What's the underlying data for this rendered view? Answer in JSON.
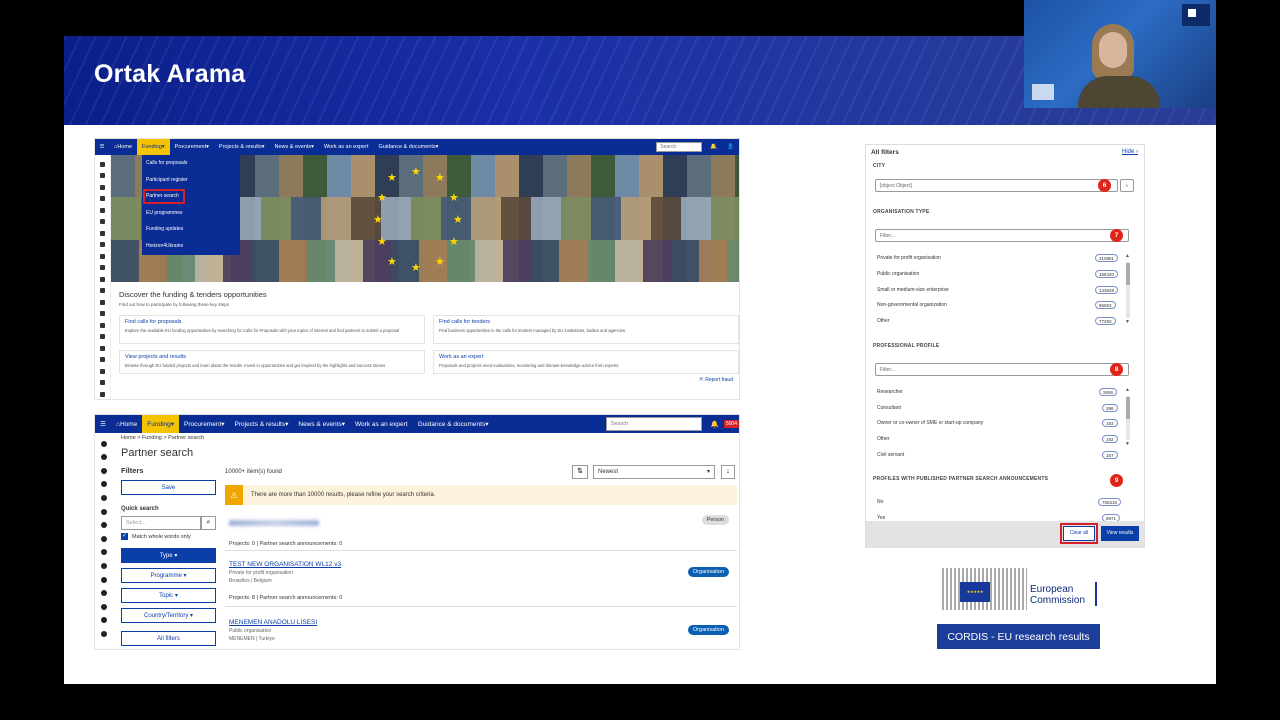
{
  "slide": {
    "title": "Ortak Arama",
    "page_number": ""
  },
  "shot1": {
    "nav": [
      "Home",
      "Funding",
      "Procurement",
      "Projects & results",
      "News & events",
      "Work as an expert",
      "Guidance & documents"
    ],
    "search_placeholder": "Search",
    "dropdown": [
      "Calls for proposals",
      "Participant register",
      "Partner search",
      "EU programmes",
      "Funding updates",
      "Horizon4Ukraine"
    ],
    "discover_title": "Discover the funding & tenders opportunities",
    "discover_sub": "Find out how to participate by following these key steps",
    "cards": [
      {
        "title": "Find calls for proposals",
        "desc": "Explore the available EU funding opportunities by searching for Calls for Proposals with your topics of interest and find partners to submit a proposal"
      },
      {
        "title": "Find calls for tenders",
        "desc": "Find business opportunities in the calls for tenders managed by EU institutions, bodies and agencies."
      },
      {
        "title": "View projects and results",
        "desc": "Browse through EU funded projects and learn about the results. Invest in opportunities and get inspired by the highlights and success stories"
      },
      {
        "title": "Work as an expert",
        "desc": "Proposals and projects need evaluations, monitoring and domain-knowledge advice from experts"
      }
    ],
    "report_fraud": "Report fraud"
  },
  "shot2": {
    "nav": [
      "Home",
      "Funding",
      "Procurement",
      "Projects & results",
      "News & events",
      "Work as an expert",
      "Guidance & documents"
    ],
    "search_placeholder": "Search",
    "notif_count": "5004",
    "breadcrumb": "Home  >  Funding  >  Partner search",
    "title": "Partner search",
    "filters_label": "Filters",
    "save": "Save",
    "quick_search": "Quick search",
    "select_placeholder": "Select...",
    "match_whole": "Match whole words only",
    "type": "Type",
    "programme": "Programme",
    "topic": "Topic",
    "country": "Country/Territory",
    "all_filters": "All filters",
    "results_count": "10000+ item(s) found",
    "sort": "Newest",
    "warning": "There are more than 10000 results, please refine your search criteria.",
    "results": [
      {
        "title": "",
        "sub": "",
        "meta": "Projects: 0   |   Partner search announcements: 0",
        "badge": "Person"
      },
      {
        "title": "TEST NEW ORGANISATION WL12 v3",
        "sub": "Private for profit organisation",
        "loc": "Bruxelles   |   Belgium",
        "meta": "Projects: 8   |   Partner search announcements: 0",
        "badge": "Organisation"
      },
      {
        "title": "MENEMEN ANADOLU LISESI",
        "sub": "Public organisation",
        "loc": "MENEMEN   |   Turkiye",
        "meta": "",
        "badge": "Organisation"
      }
    ]
  },
  "filters_panel": {
    "title": "All filters",
    "hide": "Hide",
    "city_label": "CITY",
    "city_value": "[object Object]",
    "org_type_label": "ORGANISATION TYPE",
    "filter_placeholder": "Filter...",
    "org_types": [
      {
        "name": "Private for profit organisation",
        "count": "210861"
      },
      {
        "name": "Public organisation",
        "count": "158420"
      },
      {
        "name": "Small or medium-size enterprise",
        "count": "143628"
      },
      {
        "name": "Non-governmental organization",
        "count": "86653"
      },
      {
        "name": "Other",
        "count": "77250"
      }
    ],
    "prof_label": "PROFESSIONAL PROFILE",
    "profiles": [
      {
        "name": "Researcher",
        "count": "2656"
      },
      {
        "name": "Consultant",
        "count": "396"
      },
      {
        "name": "Owner or co-owner of SME or start-up company",
        "count": "183"
      },
      {
        "name": "Other",
        "count": "192"
      },
      {
        "name": "Civil servant",
        "count": "167"
      }
    ],
    "published_label": "PROFILES WITH PUBLISHED PARTNER SEARCH ANNOUNCEMENTS",
    "published": [
      {
        "name": "No",
        "count": "765316"
      },
      {
        "name": "Yes",
        "count": "8971"
      }
    ],
    "clear_all": "Clear all",
    "view_results": "View results",
    "markers": [
      "6",
      "7",
      "8",
      "9"
    ]
  },
  "ec": {
    "line1": "European",
    "line2": "Commission",
    "cordis": "CORDIS - EU research results"
  },
  "colors": {
    "banner": "#1a2fa8",
    "nav": "#0a2c95",
    "accent_yellow": "#f5c400",
    "marker_red": "#e2231a"
  }
}
